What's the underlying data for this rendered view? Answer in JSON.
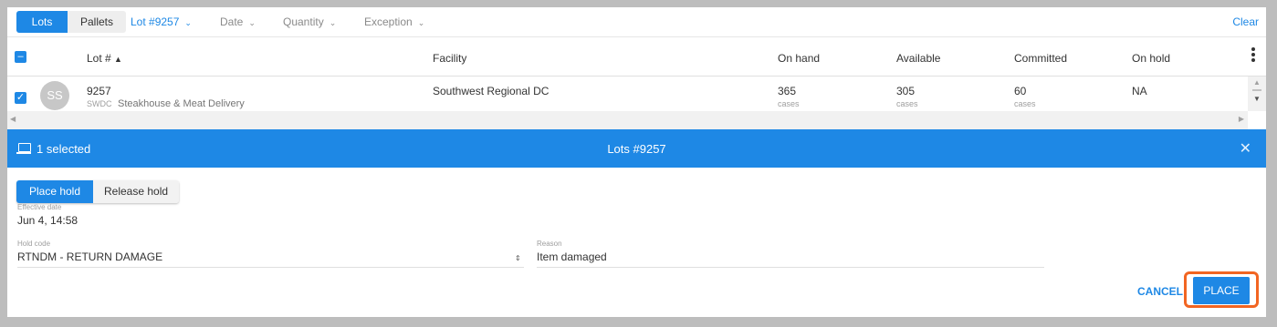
{
  "filterbar": {
    "lots_label": "Lots",
    "pallets_label": "Pallets",
    "lot_filter": "Lot #9257",
    "date_filter": "Date",
    "quantity_filter": "Quantity",
    "exception_filter": "Exception",
    "clear_label": "Clear"
  },
  "table": {
    "headers": {
      "lot": "Lot #",
      "facility": "Facility",
      "on_hand": "On hand",
      "available": "Available",
      "committed": "Committed",
      "on_hold": "On hold"
    },
    "rows": [
      {
        "avatar": "SS",
        "lot": "9257",
        "code": "SWDC",
        "customer": "Steakhouse & Meat Delivery",
        "facility": "Southwest Regional DC",
        "on_hand": "365",
        "on_hand_unit": "cases",
        "available": "305",
        "available_unit": "cases",
        "committed": "60",
        "committed_unit": "cases",
        "on_hold": "NA"
      }
    ]
  },
  "selection": {
    "count": "1 selected",
    "title": "Lots #9257"
  },
  "form": {
    "place_hold": "Place hold",
    "release_hold": "Release hold",
    "effective_date_label": "Effective date",
    "effective_date": "Jun 4, 14:58",
    "hold_code_label": "Hold code",
    "hold_code": "RTNDM - RETURN DAMAGE",
    "reason_label": "Reason",
    "reason": "Item damaged",
    "cancel_label": "CANCEL",
    "place_label": "PLACE"
  },
  "colors": {
    "accent": "#1e88e5",
    "highlight": "#f26522"
  }
}
